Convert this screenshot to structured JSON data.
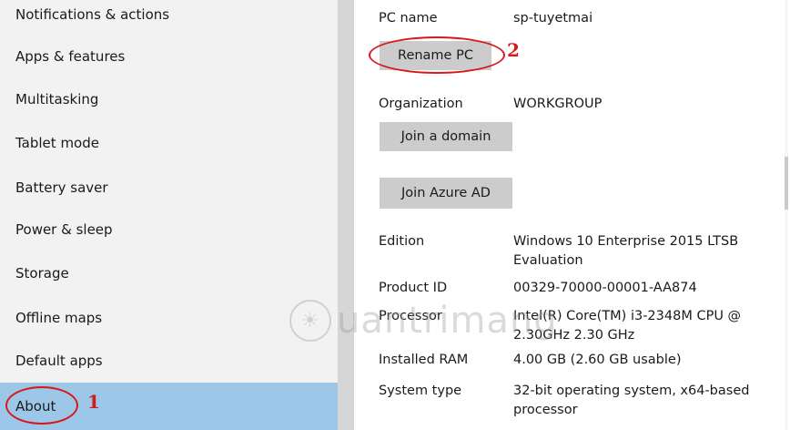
{
  "sidebar": {
    "items": [
      {
        "label": "Notifications & actions"
      },
      {
        "label": "Apps & features"
      },
      {
        "label": "Multitasking"
      },
      {
        "label": "Tablet mode"
      },
      {
        "label": "Battery saver"
      },
      {
        "label": "Power & sleep"
      },
      {
        "label": "Storage"
      },
      {
        "label": "Offline maps"
      },
      {
        "label": "Default apps"
      },
      {
        "label": "About",
        "selected": true
      }
    ]
  },
  "about": {
    "pc_name_label": "PC name",
    "pc_name_value": "sp-tuyetmai",
    "rename_button": "Rename PC",
    "organization_label": "Organization",
    "organization_value": "WORKGROUP",
    "join_domain_button": "Join a domain",
    "join_azure_button": "Join Azure AD",
    "edition_label": "Edition",
    "edition_value": "Windows 10 Enterprise 2015 LTSB Evaluation",
    "product_id_label": "Product ID",
    "product_id_value": "00329-70000-00001-AA874",
    "processor_label": "Processor",
    "processor_value": "Intel(R) Core(TM) i3-2348M CPU @ 2.30GHz   2.30 GHz",
    "ram_label": "Installed RAM",
    "ram_value": "4.00 GB (2.60 GB usable)",
    "system_type_label": "System type",
    "system_type_value": "32-bit operating system, x64-based processor"
  },
  "annotations": {
    "step1": "1",
    "step2": "2",
    "color": "#d7191c"
  },
  "watermark": {
    "text": "uantrimang",
    "icon": "lightbulb-icon"
  },
  "colors": {
    "selected_bg": "#9cc7e8",
    "sidebar_bg": "#f2f2f2",
    "button_bg": "#cccccc"
  }
}
